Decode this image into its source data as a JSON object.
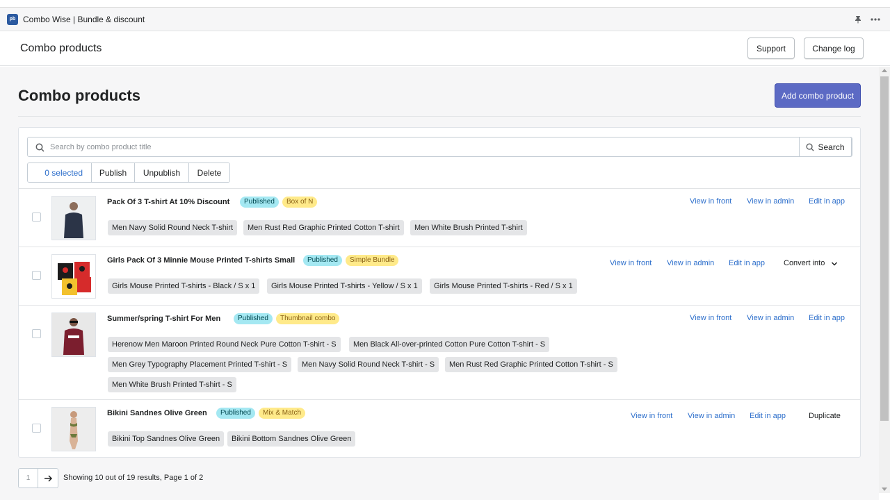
{
  "app": {
    "logo_text": "pb",
    "name": "Combo Wise | Bundle & discount"
  },
  "header": {
    "title": "Combo products",
    "support_label": "Support",
    "changelog_label": "Change log"
  },
  "main": {
    "title": "Combo products",
    "add_label": "Add combo product"
  },
  "search": {
    "placeholder": "Search by combo product title",
    "button_label": "Search"
  },
  "bulk": {
    "selected": "0 selected",
    "publish": "Publish",
    "unpublish": "Unpublish",
    "delete": "Delete"
  },
  "rows": [
    {
      "title": "Pack Of 3 T-shirt At 10% Discount",
      "status": "Published",
      "type": "Box of N",
      "view_front": "View in front",
      "view_admin": "View in admin",
      "edit_app": "Edit in app",
      "chips": [
        "Men Navy Solid Round Neck T-shirt",
        "Men Rust Red Graphic Printed Cotton T-shirt",
        "Men White Brush Printed T-shirt"
      ]
    },
    {
      "title": "Girls Pack Of 3 Minnie Mouse Printed T-shirts Small",
      "status": "Published",
      "type": "Simple Bundle",
      "view_front": "View in front",
      "view_admin": "View in admin",
      "edit_app": "Edit in app",
      "extra": "Convert into",
      "chips": [
        "Girls Mouse Printed T-shirts - Black / S  x 1",
        "Girls Mouse Printed T-shirts - Yellow / S  x 1",
        "Girls Mouse Printed T-shirts - Red / S  x 1"
      ]
    },
    {
      "title": "Summer/spring T-shirt For Men",
      "status": "Published",
      "type": "Thumbnail combo",
      "view_front": "View in front",
      "view_admin": "View in admin",
      "edit_app": "Edit in app",
      "chips": [
        "Herenow Men Maroon Printed Round Neck Pure Cotton T-shirt - S",
        "Men Black All-over-printed Cotton Pure Cotton T-shirt - S",
        "Men Grey Typography Placement Printed T-shirt - S",
        "Men Navy Solid Round Neck T-shirt - S",
        "Men Rust Red Graphic Printed Cotton T-shirt - S",
        "Men White Brush Printed T-shirt - S"
      ]
    },
    {
      "title": "Bikini Sandnes Olive Green",
      "status": "Published",
      "type": "Mix & Match",
      "view_front": "View in front",
      "view_admin": "View in admin",
      "edit_app": "Edit in app",
      "extra": "Duplicate",
      "chips": [
        "Bikini Top Sandnes Olive Green",
        "Bikini Bottom Sandnes Olive Green"
      ]
    }
  ],
  "pagination": {
    "page": "1",
    "summary": "Showing 10 out of 19 results, Page 1 of 2"
  }
}
